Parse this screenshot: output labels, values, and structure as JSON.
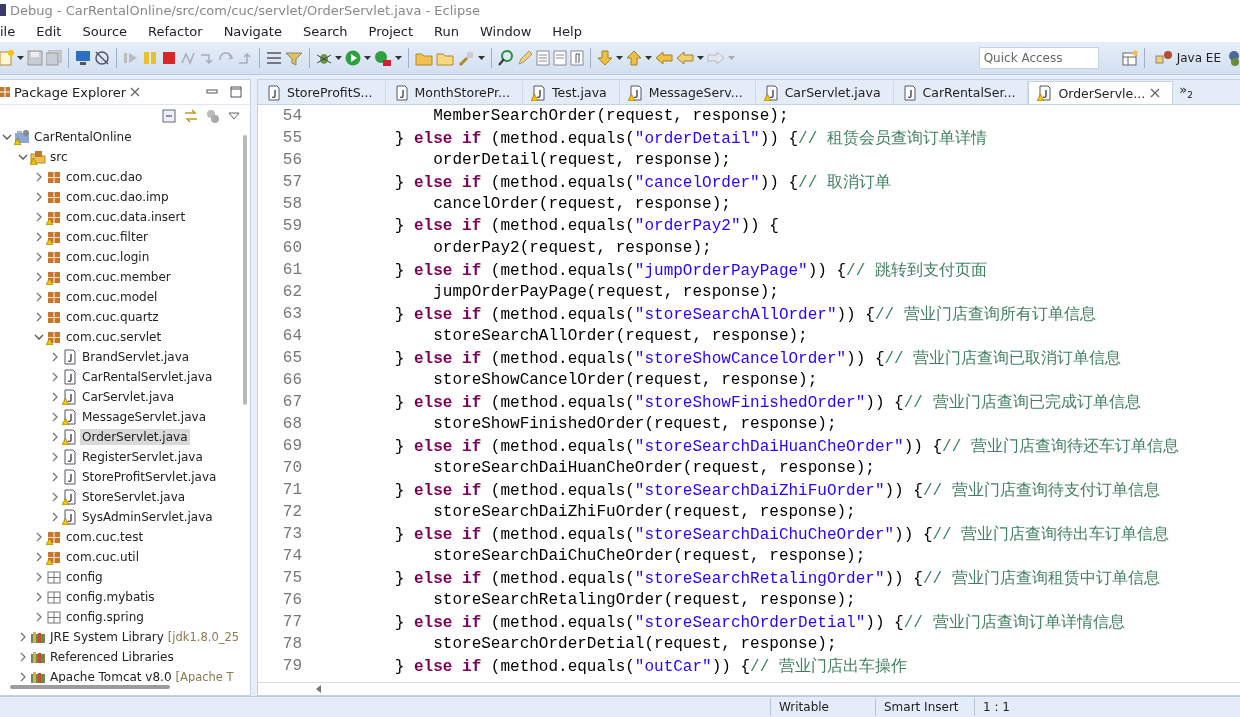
{
  "window": {
    "title": "Debug - CarRentalOnline/src/com/cuc/servlet/OrderServlet.java - Eclipse"
  },
  "menu": [
    "ile",
    "Edit",
    "Source",
    "Refactor",
    "Navigate",
    "Search",
    "Project",
    "Run",
    "Window",
    "Help"
  ],
  "toolbar": {
    "quick_access": {
      "placeholder": "Quick Access"
    },
    "perspective": "Java EE"
  },
  "package_explorer": {
    "title": "Package Explorer",
    "tree": [
      {
        "label": "CarRentalOnline",
        "kind": "project",
        "warning": true,
        "expanded": true,
        "selected": false,
        "children": [
          {
            "label": "src",
            "kind": "source-folder",
            "warning": true,
            "expanded": true,
            "selected": false,
            "children": [
              {
                "label": "com.cuc.dao",
                "kind": "package",
                "warning": false,
                "expanded": false,
                "selected": false
              },
              {
                "label": "com.cuc.dao.imp",
                "kind": "package",
                "warning": false,
                "expanded": false,
                "selected": false
              },
              {
                "label": "com.cuc.data.insert",
                "kind": "package",
                "warning": true,
                "expanded": false,
                "selected": false
              },
              {
                "label": "com.cuc.filter",
                "kind": "package",
                "warning": true,
                "expanded": false,
                "selected": false
              },
              {
                "label": "com.cuc.login",
                "kind": "package",
                "warning": false,
                "expanded": false,
                "selected": false
              },
              {
                "label": "com.cuc.member",
                "kind": "package",
                "warning": true,
                "expanded": false,
                "selected": false
              },
              {
                "label": "com.cuc.model",
                "kind": "package",
                "warning": false,
                "expanded": false,
                "selected": false
              },
              {
                "label": "com.cuc.quartz",
                "kind": "package",
                "warning": false,
                "expanded": false,
                "selected": false
              },
              {
                "label": "com.cuc.servlet",
                "kind": "package",
                "warning": true,
                "expanded": true,
                "selected": false,
                "children": [
                  {
                    "label": "BrandServlet.java",
                    "kind": "java",
                    "warning": false,
                    "expanded": false,
                    "selected": false
                  },
                  {
                    "label": "CarRentalServlet.java",
                    "kind": "java",
                    "warning": false,
                    "expanded": false,
                    "selected": false
                  },
                  {
                    "label": "CarServlet.java",
                    "kind": "java",
                    "warning": true,
                    "expanded": false,
                    "selected": false
                  },
                  {
                    "label": "MessageServlet.java",
                    "kind": "java",
                    "warning": true,
                    "expanded": false,
                    "selected": false
                  },
                  {
                    "label": "OrderServlet.java",
                    "kind": "java",
                    "warning": true,
                    "expanded": false,
                    "selected": true
                  },
                  {
                    "label": "RegisterServlet.java",
                    "kind": "java",
                    "warning": false,
                    "expanded": false,
                    "selected": false
                  },
                  {
                    "label": "StoreProfitServlet.java",
                    "kind": "java",
                    "warning": false,
                    "expanded": false,
                    "selected": false
                  },
                  {
                    "label": "StoreServlet.java",
                    "kind": "java",
                    "warning": true,
                    "expanded": false,
                    "selected": false
                  },
                  {
                    "label": "SysAdminServlet.java",
                    "kind": "java",
                    "warning": true,
                    "expanded": false,
                    "selected": false
                  }
                ]
              },
              {
                "label": "com.cuc.test",
                "kind": "package",
                "warning": true,
                "expanded": false,
                "selected": false
              },
              {
                "label": "com.cuc.util",
                "kind": "package",
                "warning": true,
                "expanded": false,
                "selected": false
              },
              {
                "label": "config",
                "kind": "folder-package",
                "warning": false,
                "expanded": false,
                "selected": false
              },
              {
                "label": "config.mybatis",
                "kind": "folder-package",
                "warning": false,
                "expanded": false,
                "selected": false
              },
              {
                "label": "config.spring",
                "kind": "folder-package",
                "warning": false,
                "expanded": false,
                "selected": false
              }
            ]
          },
          {
            "label": "JRE System Library",
            "detail": "[jdk1.8.0_25",
            "kind": "library",
            "warning": false,
            "expanded": false,
            "selected": false
          },
          {
            "label": "Referenced Libraries",
            "kind": "library",
            "warning": false,
            "expanded": false,
            "selected": false
          },
          {
            "label": "Apache Tomcat v8.0",
            "detail": "[Apache T",
            "kind": "library",
            "warning": false,
            "expanded": false,
            "selected": false
          }
        ]
      }
    ]
  },
  "editor": {
    "tabs": [
      {
        "label": "StoreProfitS...",
        "warning": false,
        "selected": false
      },
      {
        "label": "MonthStorePr...",
        "warning": false,
        "selected": false
      },
      {
        "label": "Test.java",
        "warning": true,
        "selected": false
      },
      {
        "label": "MessageServ...",
        "warning": true,
        "selected": false
      },
      {
        "label": "CarServlet.java",
        "warning": true,
        "selected": false
      },
      {
        "label": "CarRentalSer...",
        "warning": false,
        "selected": false
      },
      {
        "label": "OrderServle...",
        "warning": true,
        "selected": true
      }
    ],
    "overflow": {
      "mark": "»",
      "count": "2"
    },
    "lines": [
      {
        "number": "54",
        "tokens": [
          {
            "kind": "plain",
            "text": "            MemberSearchOrder(request, response);"
          }
        ]
      },
      {
        "number": "55",
        "tokens": [
          {
            "kind": "plain",
            "text": "        } "
          },
          {
            "kind": "keyword",
            "text": "else if"
          },
          {
            "kind": "plain",
            "text": " (method.equals("
          },
          {
            "kind": "string",
            "text": "\"orderDetail\""
          },
          {
            "kind": "plain",
            "text": ")) {"
          },
          {
            "kind": "comment",
            "text": "// 租赁会员查询订单详情"
          }
        ]
      },
      {
        "number": "56",
        "tokens": [
          {
            "kind": "plain",
            "text": "            orderDetail(request, response);"
          }
        ]
      },
      {
        "number": "57",
        "tokens": [
          {
            "kind": "plain",
            "text": "        } "
          },
          {
            "kind": "keyword",
            "text": "else if"
          },
          {
            "kind": "plain",
            "text": " (method.equals("
          },
          {
            "kind": "string",
            "text": "\"cancelOrder\""
          },
          {
            "kind": "plain",
            "text": ")) {"
          },
          {
            "kind": "comment",
            "text": "// 取消订单"
          }
        ]
      },
      {
        "number": "58",
        "tokens": [
          {
            "kind": "plain",
            "text": "            cancelOrder(request, response);"
          }
        ]
      },
      {
        "number": "59",
        "tokens": [
          {
            "kind": "plain",
            "text": "        } "
          },
          {
            "kind": "keyword",
            "text": "else if"
          },
          {
            "kind": "plain",
            "text": " (method.equals("
          },
          {
            "kind": "string",
            "text": "\"orderPay2\""
          },
          {
            "kind": "plain",
            "text": ")) {"
          }
        ]
      },
      {
        "number": "60",
        "tokens": [
          {
            "kind": "plain",
            "text": "            orderPay2(request, response);"
          }
        ]
      },
      {
        "number": "61",
        "tokens": [
          {
            "kind": "plain",
            "text": "        } "
          },
          {
            "kind": "keyword",
            "text": "else if"
          },
          {
            "kind": "plain",
            "text": " (method.equals("
          },
          {
            "kind": "string",
            "text": "\"jumpOrderPayPage\""
          },
          {
            "kind": "plain",
            "text": ")) {"
          },
          {
            "kind": "comment",
            "text": "// 跳转到支付页面"
          }
        ]
      },
      {
        "number": "62",
        "tokens": [
          {
            "kind": "plain",
            "text": "            jumpOrderPayPage(request, response);"
          }
        ]
      },
      {
        "number": "63",
        "tokens": [
          {
            "kind": "plain",
            "text": "        } "
          },
          {
            "kind": "keyword",
            "text": "else if"
          },
          {
            "kind": "plain",
            "text": " (method.equals("
          },
          {
            "kind": "string",
            "text": "\"storeSearchAllOrder\""
          },
          {
            "kind": "plain",
            "text": ")) {"
          },
          {
            "kind": "comment",
            "text": "// 营业门店查询所有订单信息"
          }
        ]
      },
      {
        "number": "64",
        "tokens": [
          {
            "kind": "plain",
            "text": "            storeSearchAllOrder(request, response);"
          }
        ]
      },
      {
        "number": "65",
        "tokens": [
          {
            "kind": "plain",
            "text": "        } "
          },
          {
            "kind": "keyword",
            "text": "else if"
          },
          {
            "kind": "plain",
            "text": " (method.equals("
          },
          {
            "kind": "string",
            "text": "\"storeShowCancelOrder\""
          },
          {
            "kind": "plain",
            "text": ")) {"
          },
          {
            "kind": "comment",
            "text": "// 营业门店查询已取消订单信息"
          }
        ]
      },
      {
        "number": "66",
        "tokens": [
          {
            "kind": "plain",
            "text": "            storeShowCancelOrder(request, response);"
          }
        ]
      },
      {
        "number": "67",
        "tokens": [
          {
            "kind": "plain",
            "text": "        } "
          },
          {
            "kind": "keyword",
            "text": "else if"
          },
          {
            "kind": "plain",
            "text": " (method.equals("
          },
          {
            "kind": "string",
            "text": "\"storeShowFinishedOrder\""
          },
          {
            "kind": "plain",
            "text": ")) {"
          },
          {
            "kind": "comment",
            "text": "// 营业门店查询已完成订单信息"
          }
        ]
      },
      {
        "number": "68",
        "tokens": [
          {
            "kind": "plain",
            "text": "            storeShowFinishedOrder(request, response);"
          }
        ]
      },
      {
        "number": "69",
        "tokens": [
          {
            "kind": "plain",
            "text": "        } "
          },
          {
            "kind": "keyword",
            "text": "else if"
          },
          {
            "kind": "plain",
            "text": " (method.equals("
          },
          {
            "kind": "string",
            "text": "\"storeSearchDaiHuanCheOrder\""
          },
          {
            "kind": "plain",
            "text": ")) {"
          },
          {
            "kind": "comment",
            "text": "// 营业门店查询待还车订单信息"
          }
        ]
      },
      {
        "number": "70",
        "tokens": [
          {
            "kind": "plain",
            "text": "            storeSearchDaiHuanCheOrder(request, response);"
          }
        ]
      },
      {
        "number": "71",
        "tokens": [
          {
            "kind": "plain",
            "text": "        } "
          },
          {
            "kind": "keyword",
            "text": "else if"
          },
          {
            "kind": "plain",
            "text": " (method.equals("
          },
          {
            "kind": "string",
            "text": "\"storeSearchDaiZhiFuOrder\""
          },
          {
            "kind": "plain",
            "text": ")) {"
          },
          {
            "kind": "comment",
            "text": "// 营业门店查询待支付订单信息"
          }
        ]
      },
      {
        "number": "72",
        "tokens": [
          {
            "kind": "plain",
            "text": "            storeSearchDaiZhiFuOrder(request, response);"
          }
        ]
      },
      {
        "number": "73",
        "tokens": [
          {
            "kind": "plain",
            "text": "        } "
          },
          {
            "kind": "keyword",
            "text": "else if"
          },
          {
            "kind": "plain",
            "text": " (method.equals("
          },
          {
            "kind": "string",
            "text": "\"storeSearchDaiChuCheOrder\""
          },
          {
            "kind": "plain",
            "text": ")) {"
          },
          {
            "kind": "comment",
            "text": "// 营业门店查询待出车订单信息"
          }
        ]
      },
      {
        "number": "74",
        "tokens": [
          {
            "kind": "plain",
            "text": "            storeSearchDaiChuCheOrder(request, response);"
          }
        ]
      },
      {
        "number": "75",
        "tokens": [
          {
            "kind": "plain",
            "text": "        } "
          },
          {
            "kind": "keyword",
            "text": "else if"
          },
          {
            "kind": "plain",
            "text": " (method.equals("
          },
          {
            "kind": "string",
            "text": "\"storeSearchRetalingOrder\""
          },
          {
            "kind": "plain",
            "text": ")) {"
          },
          {
            "kind": "comment",
            "text": "// 营业门店查询租赁中订单信息"
          }
        ]
      },
      {
        "number": "76",
        "tokens": [
          {
            "kind": "plain",
            "text": "            storeSearchRetalingOrder(request, response);"
          }
        ]
      },
      {
        "number": "77",
        "tokens": [
          {
            "kind": "plain",
            "text": "        } "
          },
          {
            "kind": "keyword",
            "text": "else if"
          },
          {
            "kind": "plain",
            "text": " (method.equals("
          },
          {
            "kind": "string",
            "text": "\"storeSearchOrderDetial\""
          },
          {
            "kind": "plain",
            "text": ")) {"
          },
          {
            "kind": "comment",
            "text": "// 营业门店查询订单详情信息"
          }
        ]
      },
      {
        "number": "78",
        "tokens": [
          {
            "kind": "plain",
            "text": "            storeSearchOrderDetial(request, response);"
          }
        ]
      },
      {
        "number": "79",
        "tokens": [
          {
            "kind": "plain",
            "text": "        } "
          },
          {
            "kind": "keyword",
            "text": "else if"
          },
          {
            "kind": "plain",
            "text": " (method.equals("
          },
          {
            "kind": "string",
            "text": "\"outCar\""
          },
          {
            "kind": "plain",
            "text": ")) {"
          },
          {
            "kind": "comment",
            "text": "// 营业门店出车操作"
          }
        ]
      }
    ]
  },
  "status_bar": [
    "Writable",
    "Smart Insert",
    "1 : 1"
  ]
}
